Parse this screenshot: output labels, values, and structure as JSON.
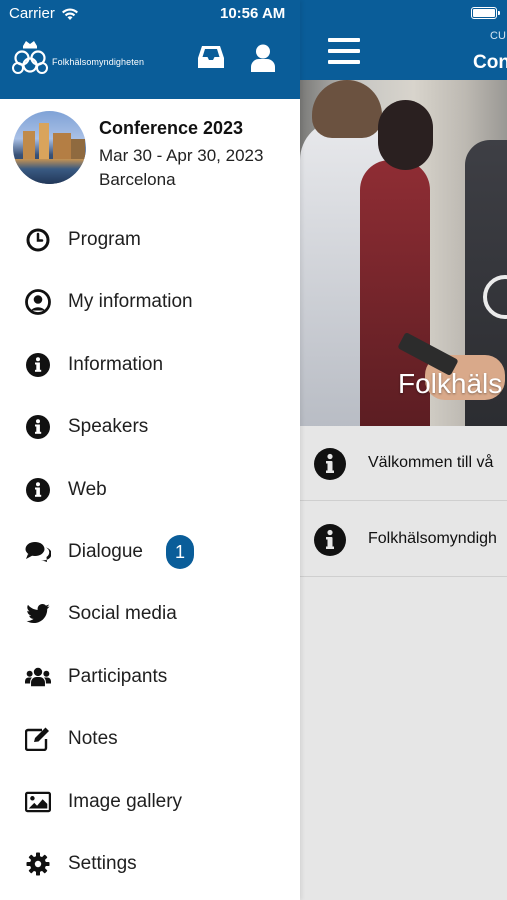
{
  "status_bar": {
    "carrier": "Carrier",
    "time": "10:56 AM"
  },
  "drawer": {
    "logo_text": "Folkhälsomyndigheten",
    "conference": {
      "title": "Conference 2023",
      "dates": "Mar 30 - Apr 30, 2023",
      "city": "Barcelona"
    },
    "items": [
      {
        "label": "Program",
        "icon": "clock-icon"
      },
      {
        "label": "My information",
        "icon": "user-circle-icon"
      },
      {
        "label": "Information",
        "icon": "info-icon"
      },
      {
        "label": "Speakers",
        "icon": "info-icon"
      },
      {
        "label": "Web",
        "icon": "info-icon"
      },
      {
        "label": "Dialogue",
        "icon": "chat-icon",
        "badge": "1"
      },
      {
        "label": "Social media",
        "icon": "twitter-icon"
      },
      {
        "label": "Participants",
        "icon": "users-icon"
      },
      {
        "label": "Notes",
        "icon": "edit-icon"
      },
      {
        "label": "Image gallery",
        "icon": "image-icon"
      },
      {
        "label": "Settings",
        "icon": "gear-icon"
      }
    ]
  },
  "main": {
    "header_sub": "CU",
    "header_title": "Con",
    "hero_text": "Folkhäls",
    "news": [
      {
        "text": "Välkommen till vå"
      },
      {
        "text": "Folkhälsomyndigh"
      }
    ]
  },
  "colors": {
    "brand_blue": "#0a5d99",
    "main_background": "#e6e6e6"
  }
}
